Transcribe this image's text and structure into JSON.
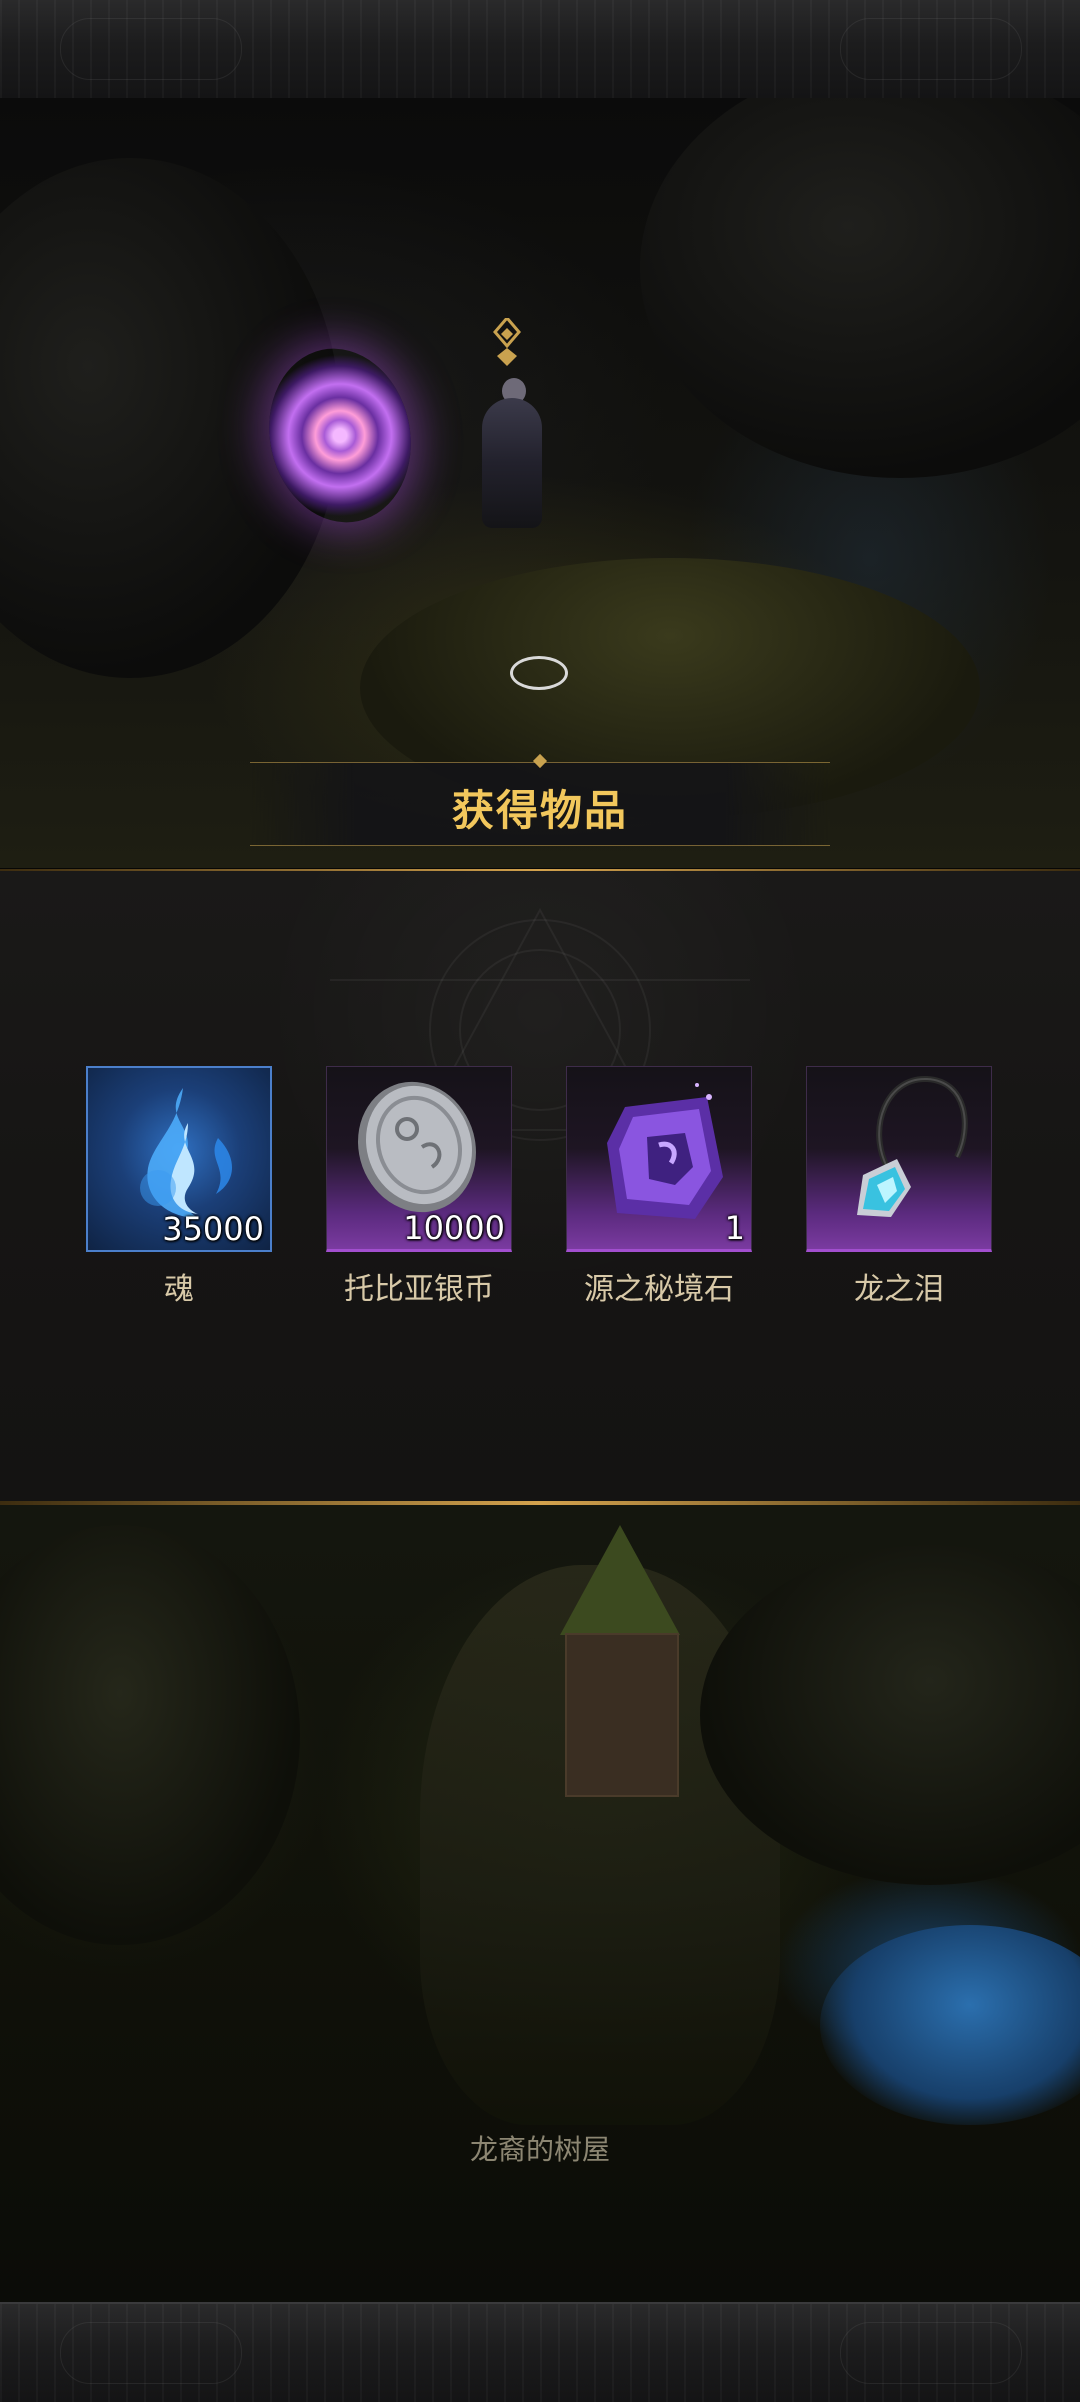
{
  "reward": {
    "title": "获得物品",
    "items": [
      {
        "name": "魂",
        "count": "35000",
        "icon": "blue-soul-flame-icon",
        "rarity_color": "#2f6fc0"
      },
      {
        "name": "托比亚银币",
        "count": "10000",
        "icon": "silver-coin-icon",
        "rarity_color": "#7a3aa0"
      },
      {
        "name": "源之秘境石",
        "count": "1",
        "icon": "purple-crystal-stone-icon",
        "rarity_color": "#7a3aa0"
      },
      {
        "name": "龙之泪",
        "count": "",
        "icon": "dragon-tear-pendant-icon",
        "rarity_color": "#7a3aa0"
      }
    ]
  },
  "location": {
    "name": "龙裔的树屋"
  },
  "colors": {
    "title_gold": "#f2c75c",
    "frame_gold": "#d3a24d",
    "item_name": "#d8c9a8"
  }
}
